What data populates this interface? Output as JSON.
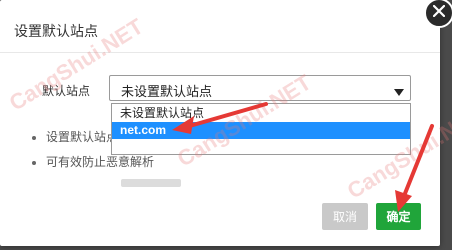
{
  "dialog": {
    "title": "设置默认站点",
    "close_icon": "close-icon"
  },
  "form": {
    "label": "默认站点",
    "select_value": "未设置默认站点"
  },
  "dropdown": {
    "options": [
      {
        "label": "未设置默认站点",
        "selected": false
      },
      {
        "label": "net.com",
        "selected": true
      },
      {
        "label": "",
        "selected": false
      }
    ]
  },
  "tips": [
    "设置默认站点",
    "可有效防止恶意解析"
  ],
  "buttons": {
    "cancel": "取消",
    "confirm": "确定"
  },
  "watermarks": [
    "CangShui.NET",
    "CangShui.NET",
    "CangShui.NET"
  ],
  "colors": {
    "confirm_bg": "#20a53a",
    "highlight_bg": "#1e90ff",
    "annotation_arrow": "#e53935"
  }
}
